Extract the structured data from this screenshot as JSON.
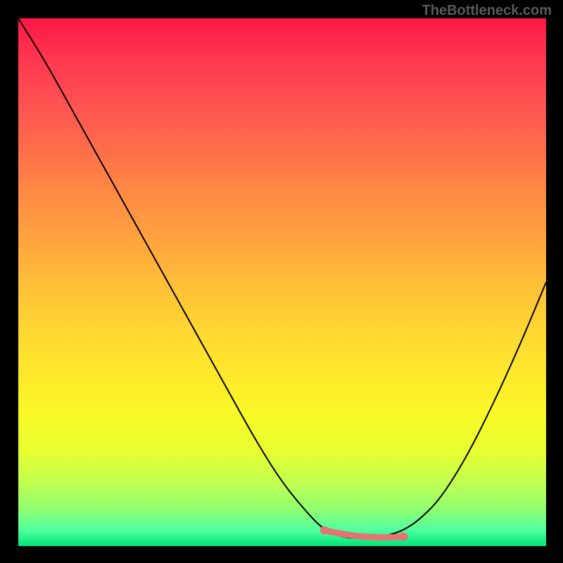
{
  "watermark": "TheBottleneck.com",
  "chart_data": {
    "type": "line",
    "title": "",
    "xlabel": "",
    "ylabel": "",
    "xlim": [
      0,
      100
    ],
    "ylim": [
      0,
      100
    ],
    "grid": false,
    "legend": false,
    "series": [
      {
        "name": "bottleneck-curve",
        "x": [
          0,
          5,
          10,
          15,
          20,
          25,
          30,
          35,
          40,
          45,
          50,
          55,
          58,
          62,
          66,
          70,
          73,
          76,
          80,
          85,
          90,
          95,
          100
        ],
        "y": [
          100,
          92,
          83,
          74,
          65,
          56,
          47,
          38,
          29,
          20,
          12,
          6,
          3,
          1.5,
          1.5,
          2,
          3,
          5,
          9,
          17,
          27,
          38,
          50
        ]
      }
    ],
    "optimal_range": {
      "x_start": 58,
      "x_end": 73,
      "y": 2
    },
    "background_gradient": {
      "top": "#ff1744",
      "mid": "#ffeb3b",
      "bottom": "#00e676"
    }
  }
}
